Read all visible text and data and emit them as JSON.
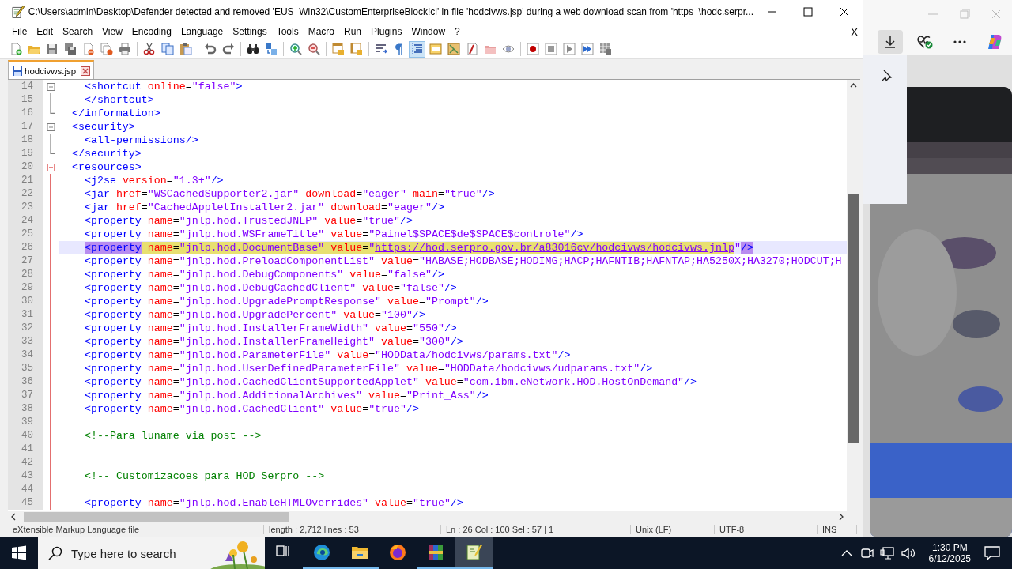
{
  "window": {
    "title": "C:\\Users\\admin\\Desktop\\Defender detected and removed 'EUS_Win32\\CustomEnterpriseBlock!cl' in file 'hodcivws.jsp' during a web download scan from 'https_\\hodc.serpr..."
  },
  "menu": [
    "File",
    "Edit",
    "Search",
    "View",
    "Encoding",
    "Language",
    "Settings",
    "Tools",
    "Macro",
    "Run",
    "Plugins",
    "Window",
    "?"
  ],
  "menu_close": "X",
  "toolbar": [
    {
      "kind": "new",
      "pressed": false
    },
    {
      "kind": "open",
      "pressed": false
    },
    {
      "kind": "save",
      "pressed": false
    },
    {
      "kind": "saveall",
      "pressed": false
    },
    {
      "kind": "close",
      "pressed": false
    },
    {
      "kind": "closeall",
      "pressed": false
    },
    {
      "kind": "print",
      "pressed": false
    },
    {
      "kind": "sep"
    },
    {
      "kind": "cut",
      "pressed": false
    },
    {
      "kind": "copy",
      "pressed": false
    },
    {
      "kind": "paste",
      "pressed": false
    },
    {
      "kind": "sep"
    },
    {
      "kind": "undo",
      "pressed": false
    },
    {
      "kind": "redo",
      "pressed": false
    },
    {
      "kind": "sep"
    },
    {
      "kind": "find",
      "pressed": false
    },
    {
      "kind": "replace",
      "pressed": false
    },
    {
      "kind": "sep"
    },
    {
      "kind": "zoomin",
      "pressed": false
    },
    {
      "kind": "zoomout",
      "pressed": false
    },
    {
      "kind": "sep"
    },
    {
      "kind": "syncv",
      "pressed": false
    },
    {
      "kind": "synch",
      "pressed": false
    },
    {
      "kind": "sep"
    },
    {
      "kind": "wrap",
      "pressed": false
    },
    {
      "kind": "pilcrow",
      "pressed": false
    },
    {
      "kind": "indent",
      "pressed": true
    },
    {
      "kind": "udl",
      "pressed": false
    },
    {
      "kind": "docmap",
      "pressed": false
    },
    {
      "kind": "funclist",
      "pressed": false
    },
    {
      "kind": "folder",
      "pressed": false
    },
    {
      "kind": "eye",
      "pressed": false
    },
    {
      "kind": "sep"
    },
    {
      "kind": "record",
      "pressed": false
    },
    {
      "kind": "stop",
      "pressed": false
    },
    {
      "kind": "play",
      "pressed": false
    },
    {
      "kind": "playmulti",
      "pressed": false
    },
    {
      "kind": "savemacro",
      "pressed": false
    }
  ],
  "tabs": [
    {
      "label": "hodcivws.jsp",
      "selected": true,
      "modified": true
    }
  ],
  "editor": {
    "lines": [
      {
        "number": "14",
        "fold_start": true,
        "fold_end": false,
        "active": false,
        "current": false,
        "nested": true,
        "tokens": [
          {
            "kind": "tag",
            "text": "<shortcut"
          },
          {
            "kind": "attr",
            "text": " online"
          },
          {
            "kind": "plain",
            "text": "="
          },
          {
            "kind": "value",
            "text": "\"false\""
          },
          {
            "kind": "tag",
            "text": ">"
          }
        ]
      },
      {
        "number": "15",
        "fold_start": false,
        "fold_end": false,
        "active": false,
        "current": false,
        "nested": true,
        "tokens": [
          {
            "kind": "tag",
            "text": "</shortcut>"
          }
        ]
      },
      {
        "number": "16",
        "fold_start": false,
        "fold_end": true,
        "active": false,
        "current": false,
        "nested": false,
        "tokens": [
          {
            "kind": "tag",
            "text": "</information>"
          }
        ]
      },
      {
        "number": "17",
        "fold_start": true,
        "fold_end": false,
        "active": false,
        "current": false,
        "nested": false,
        "tokens": [
          {
            "kind": "tag",
            "text": "<security>"
          }
        ]
      },
      {
        "number": "18",
        "fold_start": false,
        "fold_end": false,
        "active": false,
        "current": false,
        "nested": true,
        "tokens": [
          {
            "kind": "tag",
            "text": "<all-permissions/>"
          }
        ]
      },
      {
        "number": "19",
        "fold_start": false,
        "fold_end": true,
        "active": false,
        "current": false,
        "nested": false,
        "tokens": [
          {
            "kind": "tag",
            "text": "</security>"
          }
        ]
      },
      {
        "number": "20",
        "fold_start": true,
        "fold_end": false,
        "active": true,
        "current": false,
        "nested": false,
        "tokens": [
          {
            "kind": "tag",
            "text": "<resources>"
          }
        ]
      },
      {
        "number": "21",
        "fold_start": false,
        "fold_end": false,
        "active": true,
        "current": false,
        "nested": true,
        "tokens": [
          {
            "kind": "tag",
            "text": "<j2se"
          },
          {
            "kind": "attr",
            "text": " version"
          },
          {
            "kind": "plain",
            "text": "="
          },
          {
            "kind": "value",
            "text": "\"1.3+\""
          },
          {
            "kind": "tag",
            "text": "/>"
          }
        ]
      },
      {
        "number": "22",
        "fold_start": false,
        "fold_end": false,
        "active": true,
        "current": false,
        "nested": true,
        "tokens": [
          {
            "kind": "tag",
            "text": "<jar"
          },
          {
            "kind": "attr",
            "text": " href"
          },
          {
            "kind": "plain",
            "text": "="
          },
          {
            "kind": "value",
            "text": "\"WSCachedSupporter2.jar\""
          },
          {
            "kind": "attr",
            "text": " download"
          },
          {
            "kind": "plain",
            "text": "="
          },
          {
            "kind": "value",
            "text": "\"eager\""
          },
          {
            "kind": "attr",
            "text": " main"
          },
          {
            "kind": "plain",
            "text": "="
          },
          {
            "kind": "value",
            "text": "\"true\""
          },
          {
            "kind": "tag",
            "text": "/>"
          }
        ]
      },
      {
        "number": "23",
        "fold_start": false,
        "fold_end": false,
        "active": true,
        "current": false,
        "nested": true,
        "tokens": [
          {
            "kind": "tag",
            "text": "<jar"
          },
          {
            "kind": "attr",
            "text": " href"
          },
          {
            "kind": "plain",
            "text": "="
          },
          {
            "kind": "value",
            "text": "\"CachedAppletInstaller2.jar\""
          },
          {
            "kind": "attr",
            "text": " download"
          },
          {
            "kind": "plain",
            "text": "="
          },
          {
            "kind": "value",
            "text": "\"eager\""
          },
          {
            "kind": "tag",
            "text": "/>"
          }
        ]
      },
      {
        "number": "24",
        "fold_start": false,
        "fold_end": false,
        "active": true,
        "current": false,
        "nested": true,
        "tokens": [
          {
            "kind": "tag",
            "text": "<property"
          },
          {
            "kind": "attr",
            "text": " name"
          },
          {
            "kind": "plain",
            "text": "="
          },
          {
            "kind": "value",
            "text": "\"jnlp.hod.TrustedJNLP\""
          },
          {
            "kind": "attr",
            "text": " value"
          },
          {
            "kind": "plain",
            "text": "="
          },
          {
            "kind": "value",
            "text": "\"true\""
          },
          {
            "kind": "tag",
            "text": "/>"
          }
        ]
      },
      {
        "number": "25",
        "fold_start": false,
        "fold_end": false,
        "active": true,
        "current": false,
        "nested": true,
        "tokens": [
          {
            "kind": "tag",
            "text": "<property"
          },
          {
            "kind": "attr",
            "text": " name"
          },
          {
            "kind": "plain",
            "text": "="
          },
          {
            "kind": "value",
            "text": "\"jnlp.hod.WSFrameTitle\""
          },
          {
            "kind": "attr",
            "text": " value"
          },
          {
            "kind": "plain",
            "text": "="
          },
          {
            "kind": "value",
            "text": "\"Painel$SPACE$de$SPACE$controle\""
          },
          {
            "kind": "tag",
            "text": "/>"
          }
        ]
      },
      {
        "number": "26",
        "fold_start": false,
        "fold_end": false,
        "active": true,
        "current": true,
        "nested": true,
        "tokens": [
          {
            "kind": "tag",
            "text": "<property",
            "highlighted": true
          },
          {
            "kind": "attr",
            "text": " name",
            "highlighted": true
          },
          {
            "kind": "plain",
            "text": "=",
            "highlighted": true
          },
          {
            "kind": "value",
            "text": "\"jnlp.hod.DocumentBase\"",
            "highlighted": true
          },
          {
            "kind": "attr",
            "text": " value",
            "highlighted": true
          },
          {
            "kind": "plain",
            "text": "=",
            "highlighted": true
          },
          {
            "kind": "value",
            "text": "\"",
            "highlighted": true
          },
          {
            "kind": "url",
            "text": "https://hod.serpro.gov.br/a83016cv/hodcivws/hodcivws.jnlp",
            "highlighted": true
          },
          {
            "kind": "value",
            "text": "\"",
            "highlighted": false
          },
          {
            "kind": "tag",
            "text": "/>",
            "highlighted": true
          }
        ]
      },
      {
        "number": "27",
        "fold_start": false,
        "fold_end": false,
        "active": true,
        "current": false,
        "nested": true,
        "tokens": [
          {
            "kind": "tag",
            "text": "<property"
          },
          {
            "kind": "attr",
            "text": " name"
          },
          {
            "kind": "plain",
            "text": "="
          },
          {
            "kind": "value",
            "text": "\"jnlp.hod.PreloadComponentList\""
          },
          {
            "kind": "attr",
            "text": " value"
          },
          {
            "kind": "plain",
            "text": "="
          },
          {
            "kind": "value",
            "text": "\"HABASE;HODBASE;HODIMG;HACP;HAFNTIB;HAFNTAP;HA5250X;HA3270;HODCUT;H"
          }
        ]
      },
      {
        "number": "28",
        "fold_start": false,
        "fold_end": false,
        "active": true,
        "current": false,
        "nested": true,
        "tokens": [
          {
            "kind": "tag",
            "text": "<property"
          },
          {
            "kind": "attr",
            "text": " name"
          },
          {
            "kind": "plain",
            "text": "="
          },
          {
            "kind": "value",
            "text": "\"jnlp.hod.DebugComponents\""
          },
          {
            "kind": "attr",
            "text": " value"
          },
          {
            "kind": "plain",
            "text": "="
          },
          {
            "kind": "value",
            "text": "\"false\""
          },
          {
            "kind": "tag",
            "text": "/>"
          }
        ]
      },
      {
        "number": "29",
        "fold_start": false,
        "fold_end": false,
        "active": true,
        "current": false,
        "nested": true,
        "tokens": [
          {
            "kind": "tag",
            "text": "<property"
          },
          {
            "kind": "attr",
            "text": " name"
          },
          {
            "kind": "plain",
            "text": "="
          },
          {
            "kind": "value",
            "text": "\"jnlp.hod.DebugCachedClient\""
          },
          {
            "kind": "attr",
            "text": " value"
          },
          {
            "kind": "plain",
            "text": "="
          },
          {
            "kind": "value",
            "text": "\"false\""
          },
          {
            "kind": "tag",
            "text": "/>"
          }
        ]
      },
      {
        "number": "30",
        "fold_start": false,
        "fold_end": false,
        "active": true,
        "current": false,
        "nested": true,
        "tokens": [
          {
            "kind": "tag",
            "text": "<property"
          },
          {
            "kind": "attr",
            "text": " name"
          },
          {
            "kind": "plain",
            "text": "="
          },
          {
            "kind": "value",
            "text": "\"jnlp.hod.UpgradePromptResponse\""
          },
          {
            "kind": "attr",
            "text": " value"
          },
          {
            "kind": "plain",
            "text": "="
          },
          {
            "kind": "value",
            "text": "\"Prompt\""
          },
          {
            "kind": "tag",
            "text": "/>"
          }
        ]
      },
      {
        "number": "31",
        "fold_start": false,
        "fold_end": false,
        "active": true,
        "current": false,
        "nested": true,
        "tokens": [
          {
            "kind": "tag",
            "text": "<property"
          },
          {
            "kind": "attr",
            "text": " name"
          },
          {
            "kind": "plain",
            "text": "="
          },
          {
            "kind": "value",
            "text": "\"jnlp.hod.UpgradePercent\""
          },
          {
            "kind": "attr",
            "text": " value"
          },
          {
            "kind": "plain",
            "text": "="
          },
          {
            "kind": "value",
            "text": "\"100\""
          },
          {
            "kind": "tag",
            "text": "/>"
          }
        ]
      },
      {
        "number": "32",
        "fold_start": false,
        "fold_end": false,
        "active": true,
        "current": false,
        "nested": true,
        "tokens": [
          {
            "kind": "tag",
            "text": "<property"
          },
          {
            "kind": "attr",
            "text": " name"
          },
          {
            "kind": "plain",
            "text": "="
          },
          {
            "kind": "value",
            "text": "\"jnlp.hod.InstallerFrameWidth\""
          },
          {
            "kind": "attr",
            "text": " value"
          },
          {
            "kind": "plain",
            "text": "="
          },
          {
            "kind": "value",
            "text": "\"550\""
          },
          {
            "kind": "tag",
            "text": "/>"
          }
        ]
      },
      {
        "number": "33",
        "fold_start": false,
        "fold_end": false,
        "active": true,
        "current": false,
        "nested": true,
        "tokens": [
          {
            "kind": "tag",
            "text": "<property"
          },
          {
            "kind": "attr",
            "text": " name"
          },
          {
            "kind": "plain",
            "text": "="
          },
          {
            "kind": "value",
            "text": "\"jnlp.hod.InstallerFrameHeight\""
          },
          {
            "kind": "attr",
            "text": " value"
          },
          {
            "kind": "plain",
            "text": "="
          },
          {
            "kind": "value",
            "text": "\"300\""
          },
          {
            "kind": "tag",
            "text": "/>"
          }
        ]
      },
      {
        "number": "34",
        "fold_start": false,
        "fold_end": false,
        "active": true,
        "current": false,
        "nested": true,
        "tokens": [
          {
            "kind": "tag",
            "text": "<property"
          },
          {
            "kind": "attr",
            "text": " name"
          },
          {
            "kind": "plain",
            "text": "="
          },
          {
            "kind": "value",
            "text": "\"jnlp.hod.ParameterFile\""
          },
          {
            "kind": "attr",
            "text": " value"
          },
          {
            "kind": "plain",
            "text": "="
          },
          {
            "kind": "value",
            "text": "\"HODData/hodcivws/params.txt\""
          },
          {
            "kind": "tag",
            "text": "/>"
          }
        ]
      },
      {
        "number": "35",
        "fold_start": false,
        "fold_end": false,
        "active": true,
        "current": false,
        "nested": true,
        "tokens": [
          {
            "kind": "tag",
            "text": "<property"
          },
          {
            "kind": "attr",
            "text": " name"
          },
          {
            "kind": "plain",
            "text": "="
          },
          {
            "kind": "value",
            "text": "\"jnlp.hod.UserDefinedParameterFile\""
          },
          {
            "kind": "attr",
            "text": " value"
          },
          {
            "kind": "plain",
            "text": "="
          },
          {
            "kind": "value",
            "text": "\"HODData/hodcivws/udparams.txt\""
          },
          {
            "kind": "tag",
            "text": "/>"
          }
        ]
      },
      {
        "number": "36",
        "fold_start": false,
        "fold_end": false,
        "active": true,
        "current": false,
        "nested": true,
        "tokens": [
          {
            "kind": "tag",
            "text": "<property"
          },
          {
            "kind": "attr",
            "text": " name"
          },
          {
            "kind": "plain",
            "text": "="
          },
          {
            "kind": "value",
            "text": "\"jnlp.hod.CachedClientSupportedApplet\""
          },
          {
            "kind": "attr",
            "text": " value"
          },
          {
            "kind": "plain",
            "text": "="
          },
          {
            "kind": "value",
            "text": "\"com.ibm.eNetwork.HOD.HostOnDemand\""
          },
          {
            "kind": "tag",
            "text": "/>"
          }
        ]
      },
      {
        "number": "37",
        "fold_start": false,
        "fold_end": false,
        "active": true,
        "current": false,
        "nested": true,
        "tokens": [
          {
            "kind": "tag",
            "text": "<property"
          },
          {
            "kind": "attr",
            "text": " name"
          },
          {
            "kind": "plain",
            "text": "="
          },
          {
            "kind": "value",
            "text": "\"jnlp.hod.AdditionalArchives\""
          },
          {
            "kind": "attr",
            "text": " value"
          },
          {
            "kind": "plain",
            "text": "="
          },
          {
            "kind": "value",
            "text": "\"Print_Ass\""
          },
          {
            "kind": "tag",
            "text": "/>"
          }
        ]
      },
      {
        "number": "38",
        "fold_start": false,
        "fold_end": false,
        "active": true,
        "current": false,
        "nested": true,
        "tokens": [
          {
            "kind": "tag",
            "text": "<property"
          },
          {
            "kind": "attr",
            "text": " name"
          },
          {
            "kind": "plain",
            "text": "="
          },
          {
            "kind": "value",
            "text": "\"jnlp.hod.CachedClient\""
          },
          {
            "kind": "attr",
            "text": " value"
          },
          {
            "kind": "plain",
            "text": "="
          },
          {
            "kind": "value",
            "text": "\"true\""
          },
          {
            "kind": "tag",
            "text": "/>"
          }
        ]
      },
      {
        "number": "39",
        "fold_start": false,
        "fold_end": false,
        "active": true,
        "current": false
      },
      {
        "number": "40",
        "fold_start": false,
        "fold_end": false,
        "active": true,
        "current": false,
        "nested": true,
        "tokens": [
          {
            "kind": "comment",
            "text": "<!--Para luname via post -->"
          }
        ]
      },
      {
        "number": "41",
        "fold_start": false,
        "fold_end": false,
        "active": true,
        "current": false
      },
      {
        "number": "42",
        "fold_start": false,
        "fold_end": false,
        "active": true,
        "current": false
      },
      {
        "number": "43",
        "fold_start": false,
        "fold_end": false,
        "active": true,
        "current": false,
        "nested": true,
        "tokens": [
          {
            "kind": "comment",
            "text": "<!-- Customizacoes para HOD Serpro -->"
          }
        ]
      },
      {
        "number": "44",
        "fold_start": false,
        "fold_end": false,
        "active": true,
        "current": false
      },
      {
        "number": "45",
        "fold_start": false,
        "fold_end": false,
        "active": true,
        "current": false,
        "nested": true,
        "tokens": [
          {
            "kind": "tag",
            "text": "<property"
          },
          {
            "kind": "attr",
            "text": " name"
          },
          {
            "kind": "plain",
            "text": "="
          },
          {
            "kind": "value",
            "text": "\"jnlp.hod.EnableHTMLOverrides\""
          },
          {
            "kind": "attr",
            "text": " value"
          },
          {
            "kind": "plain",
            "text": "="
          },
          {
            "kind": "value",
            "text": "\"true\""
          },
          {
            "kind": "tag",
            "text": "/>"
          }
        ]
      }
    ]
  },
  "status_bar": [
    "eXtensible Markup Language file",
    "length : 2,712    lines : 53",
    "Ln : 26    Col : 100    Sel : 57 | 1",
    "Unix (LF)",
    "UTF-8",
    "INS"
  ],
  "taskbar": {
    "search": {
      "placeholder": "Type here to search"
    },
    "apps": [
      {
        "kind": "taskview",
        "running": false,
        "active": false
      },
      {
        "kind": "edge",
        "running": true,
        "active": false
      },
      {
        "kind": "explorer",
        "running": true,
        "active": false
      },
      {
        "kind": "firefox",
        "running": false,
        "active": false
      },
      {
        "kind": "winrar",
        "running": true,
        "active": false
      },
      {
        "kind": "notepad",
        "running": true,
        "active": true
      }
    ],
    "time": "1:30 PM",
    "date": "6/12/2025"
  }
}
